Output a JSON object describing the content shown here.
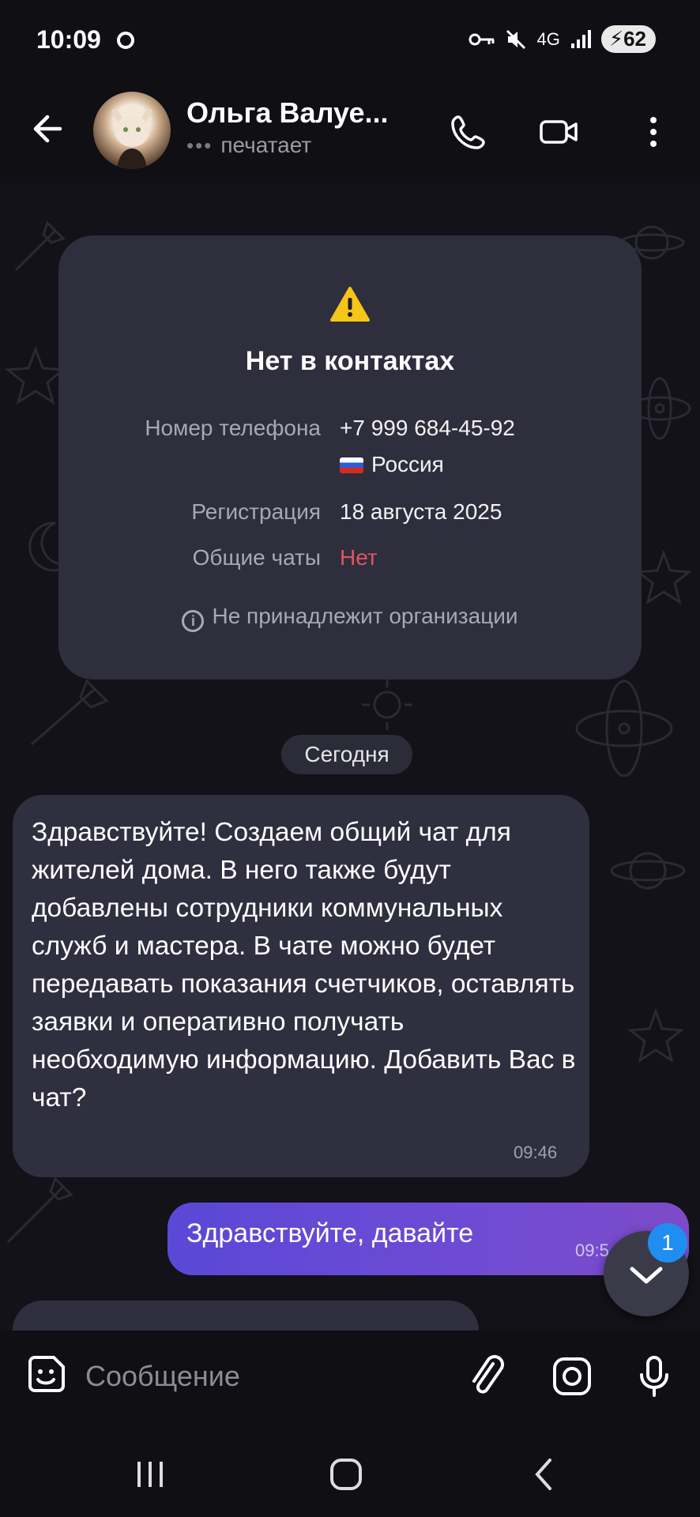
{
  "status_bar": {
    "time": "10:09",
    "network": "4G",
    "battery": "62"
  },
  "header": {
    "name": "Ольга Валуе...",
    "status": "печатает",
    "typing_indicator": "•••"
  },
  "info_card": {
    "title": "Нет в контактах",
    "rows": [
      {
        "label": "Номер телефона",
        "value": "+7 999 684-45-92"
      },
      {
        "label": "",
        "value": "Россия"
      },
      {
        "label": "Регистрация",
        "value": "18 августа 2025"
      },
      {
        "label": "Общие чаты",
        "value": "Нет"
      }
    ],
    "org_note": "Не принадлежит организации"
  },
  "date_separator": "Сегодня",
  "messages": [
    {
      "direction": "in",
      "text": "Здравствуйте! Создаем общий чат для жителей дома. В него также будут добавлены сотрудники коммунальных служб и мастера. В чате можно будет передавать показания счетчиков, оставлять заявки и оперативно получать необходимую информацию. Добавить Вас в чат?",
      "time": "09:46"
    },
    {
      "direction": "out",
      "text": "Здравствуйте, давайте",
      "time": "09:5"
    }
  ],
  "scroll_down": {
    "unread_count": "1"
  },
  "composer": {
    "placeholder": "Сообщение"
  },
  "colors": {
    "accent": "#5a48d6",
    "badge": "#1f8ef1",
    "warning": "#f5c518",
    "negative": "#e0565f"
  },
  "icons": [
    "back-arrow-icon",
    "phone-icon",
    "video-call-icon",
    "more-vertical-icon",
    "warning-icon",
    "info-icon",
    "sticker-icon",
    "attach-icon",
    "camera-icon",
    "microphone-icon",
    "chevron-down-icon"
  ]
}
